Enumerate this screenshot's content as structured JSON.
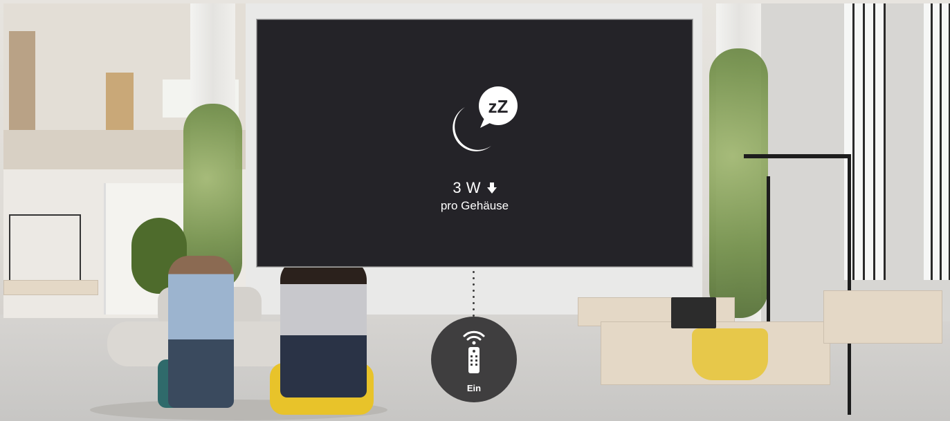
{
  "screen": {
    "sleep_icon": "moon-zzz-icon",
    "zzz_text": "zZ",
    "power_value": "3 W",
    "power_trend_icon": "arrow-down-icon",
    "power_caption": "pro Gehäuse"
  },
  "remote": {
    "icon": "remote-control-icon",
    "label": "Ein"
  },
  "colors": {
    "screen_bg": "#242328",
    "button_bg": "#3f3e3f",
    "text": "#ffffff"
  }
}
